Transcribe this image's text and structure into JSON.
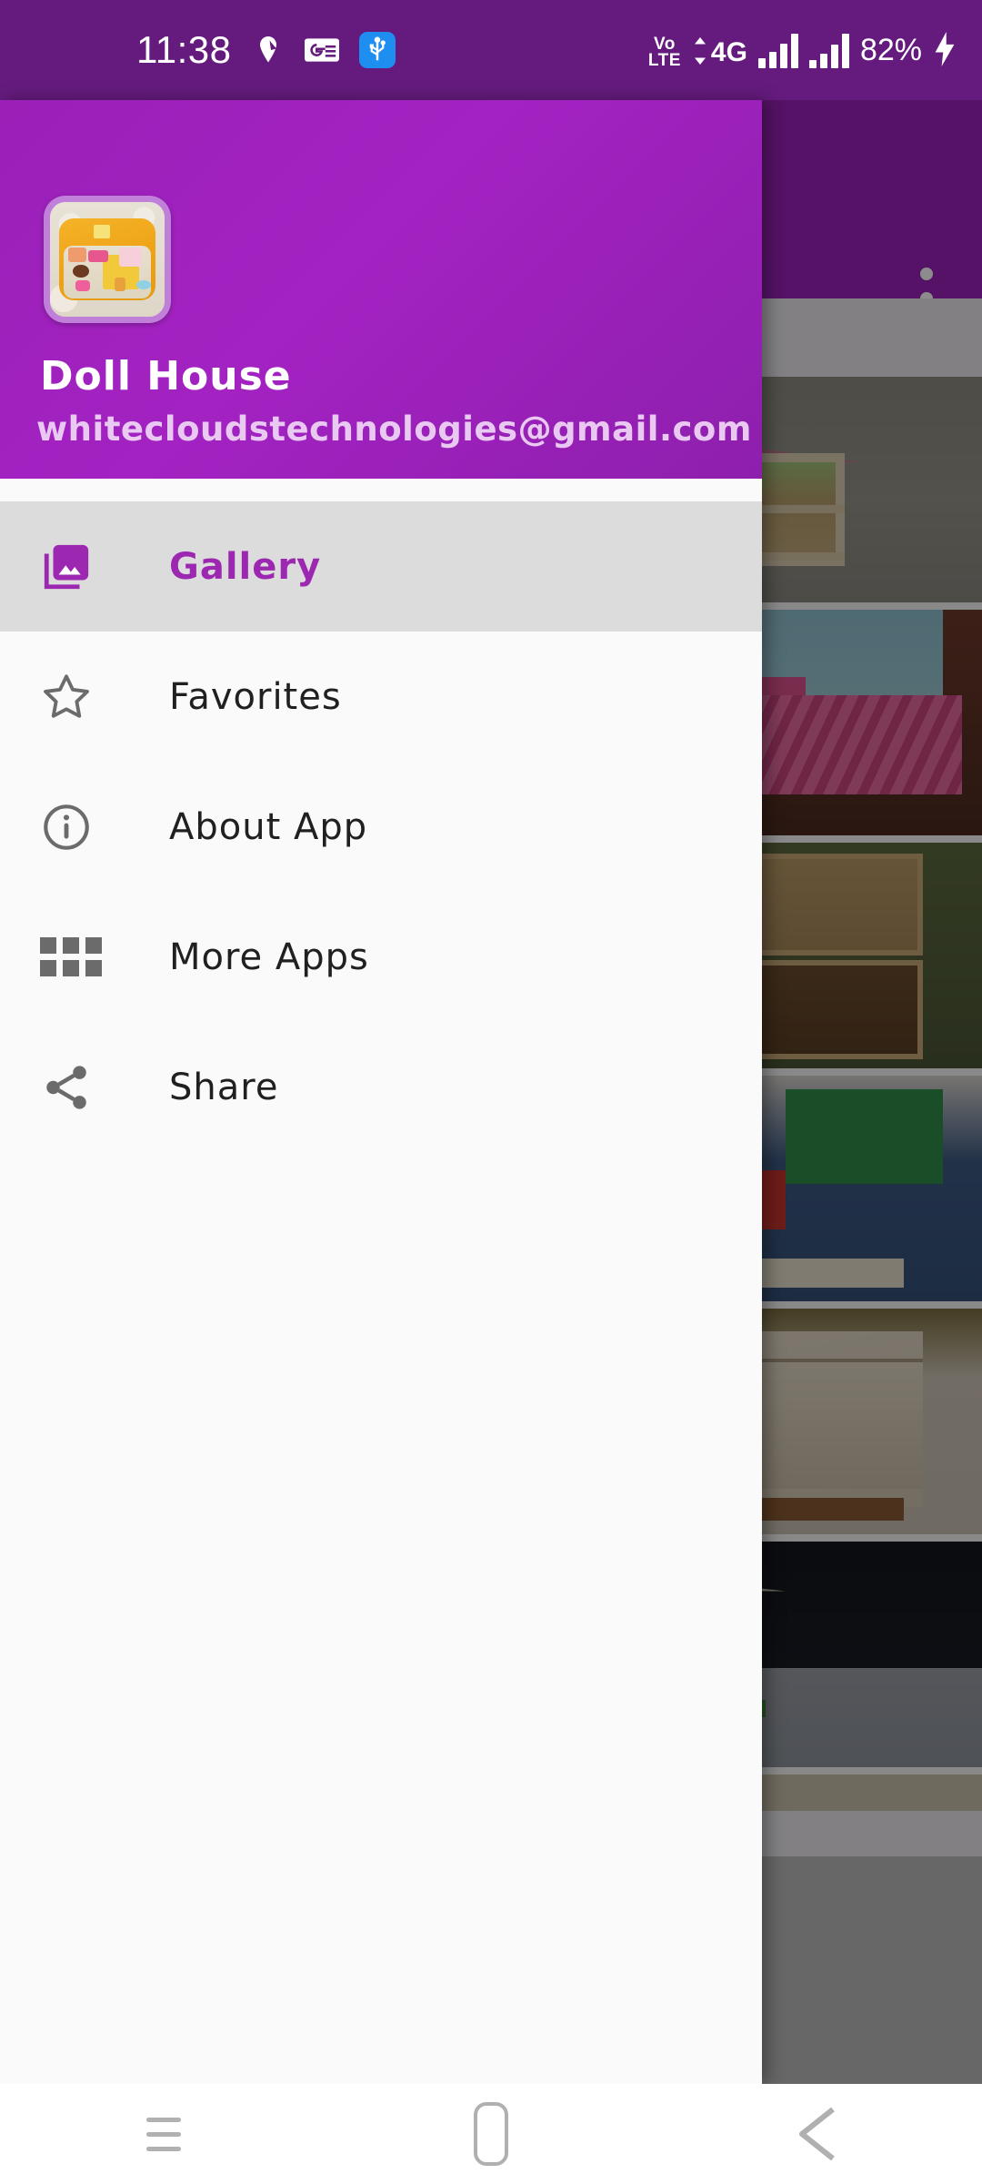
{
  "status_bar": {
    "time": "11:38",
    "icons": [
      "location-pin-icon",
      "google-news-icon",
      "usb-icon"
    ],
    "volte_line1": "Vo",
    "volte_line2": "LTE",
    "network_type": "4G",
    "battery_percent": "82%",
    "charging_icon": "lightning-bolt-icon",
    "background_color": "#651b7e"
  },
  "drawer": {
    "app_icon_name": "doll-house-app-icon",
    "title": "Doll House",
    "email": "whitecloudstechnologies@gmail.com",
    "header_color": "#a322c2",
    "accent_color": "#9c27b0",
    "email_color": "#e9c9f2",
    "items": [
      {
        "label": "Gallery",
        "icon": "photo-library-icon",
        "selected": true
      },
      {
        "label": "Favorites",
        "icon": "star-outline-icon",
        "selected": false
      },
      {
        "label": "About App",
        "icon": "info-circle-icon",
        "selected": false
      },
      {
        "label": "More Apps",
        "icon": "grid-apps-icon",
        "selected": false
      },
      {
        "label": "Share",
        "icon": "share-nodes-icon",
        "selected": false
      }
    ]
  },
  "app_behind": {
    "app_bar_color": "#9c21ba",
    "overflow_menu": "more-options-icon",
    "gallery_thumbnails": [
      {
        "name": "wooden-dollhouse-thumbnail"
      },
      {
        "name": "pink-dollhouse-thumbnail"
      },
      {
        "name": "wooden-cabin-interior-thumbnail"
      },
      {
        "name": "colorful-playhouse-thumbnail"
      },
      {
        "name": "cream-miniature-room-thumbnail"
      },
      {
        "name": "white-dollhouse-night-thumbnail"
      }
    ]
  },
  "system_nav": {
    "recents": "recents-icon",
    "home": "home-icon",
    "back": "back-icon"
  }
}
